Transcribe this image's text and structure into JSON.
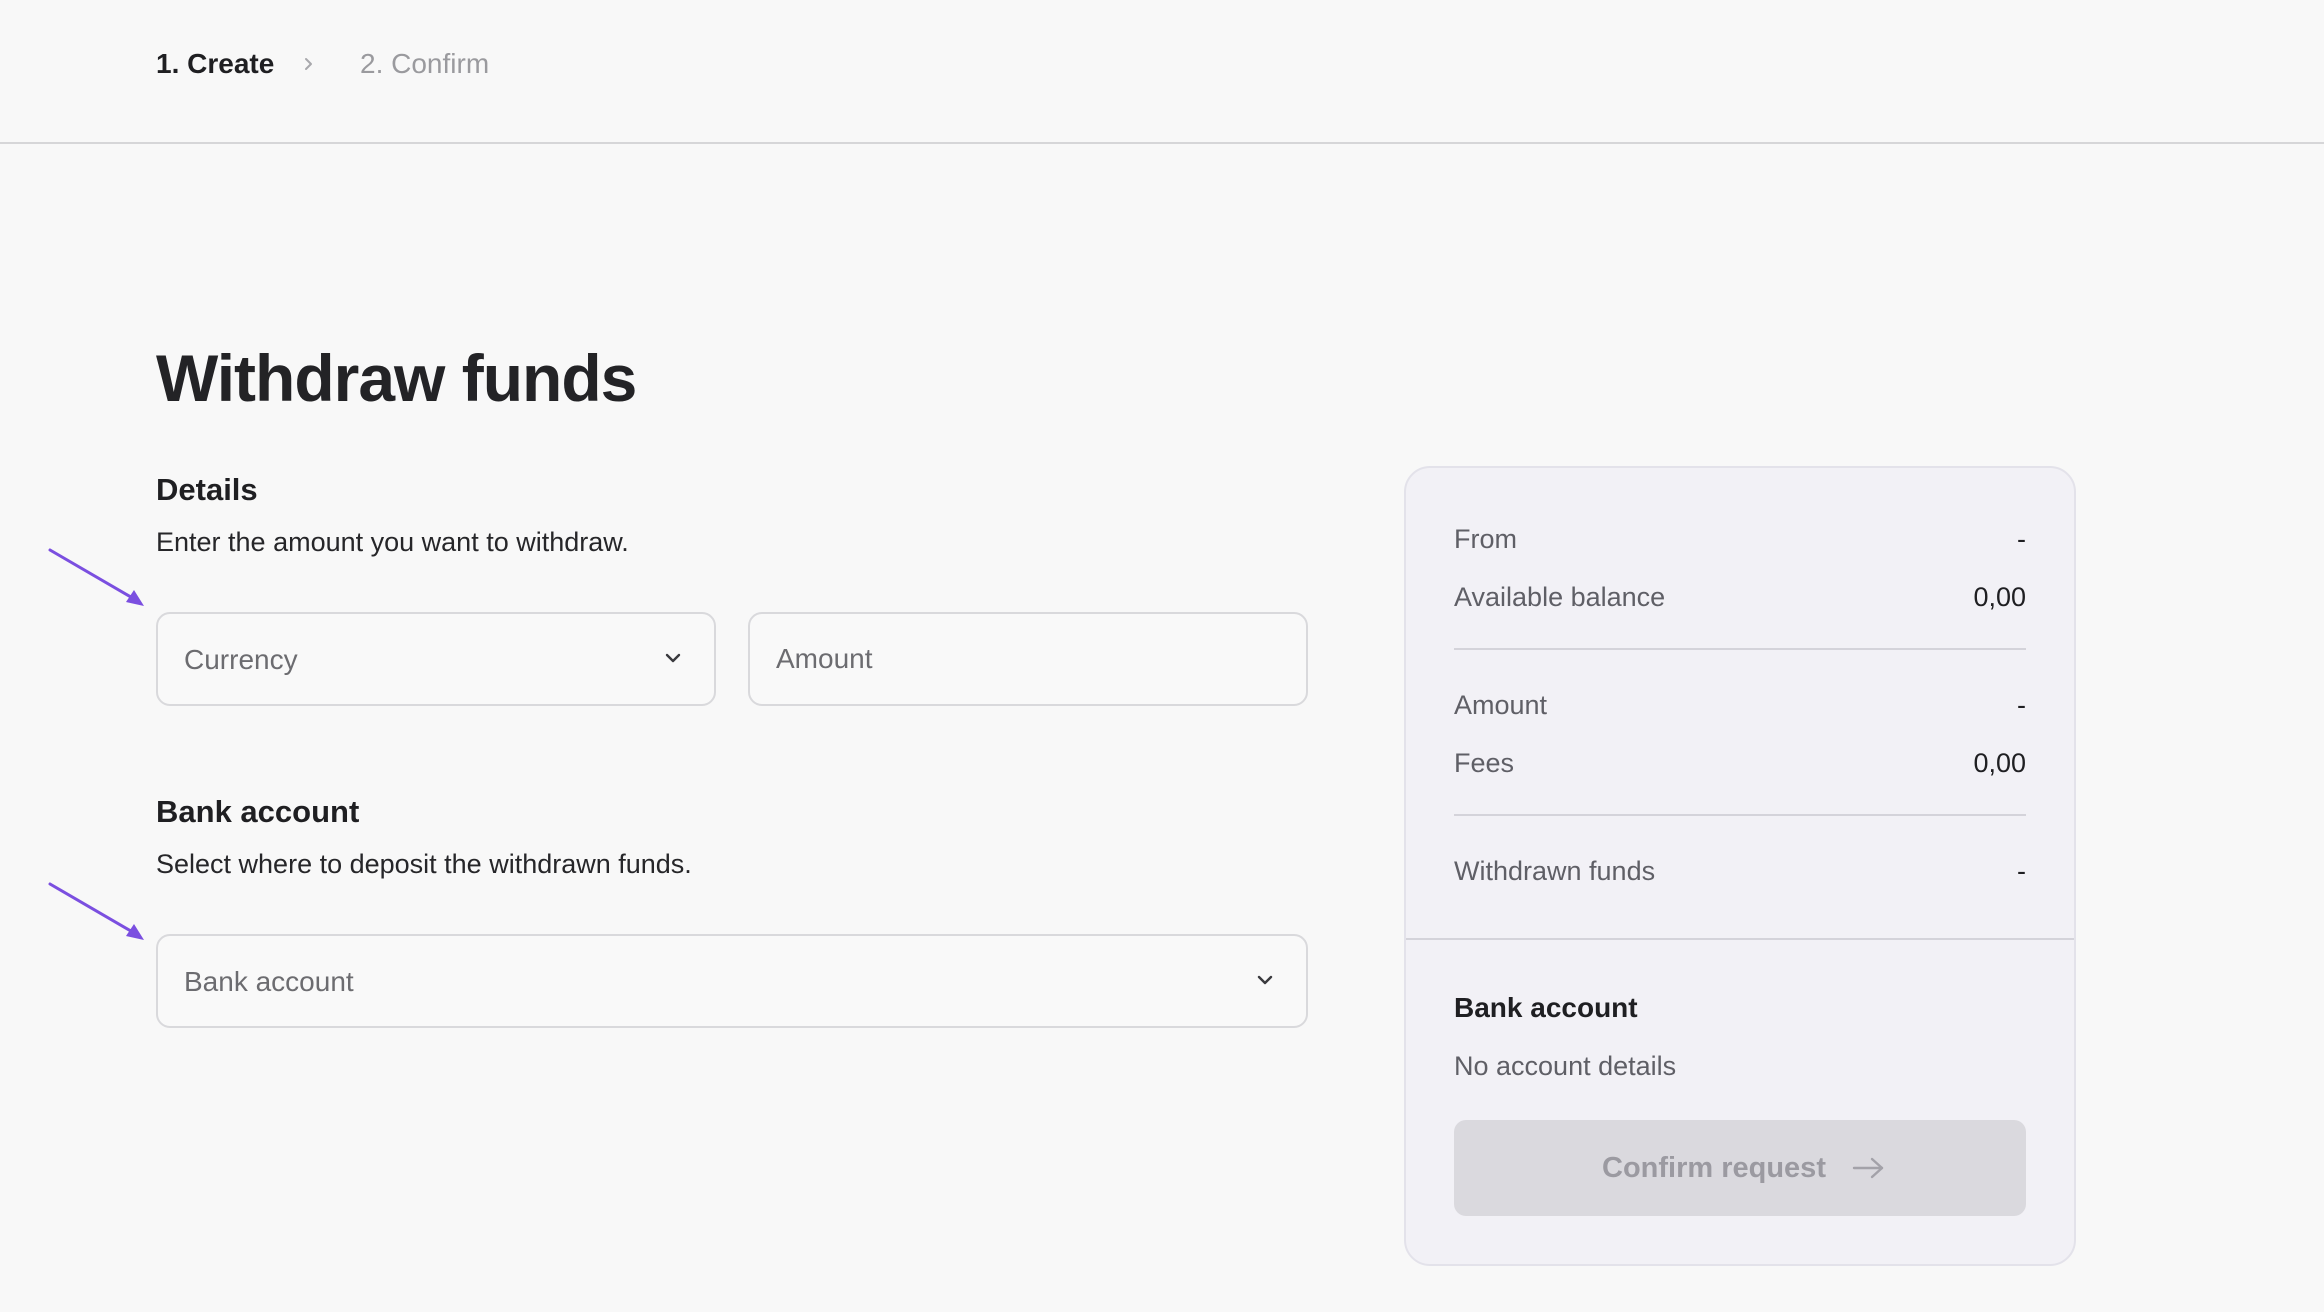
{
  "stepper": {
    "steps": [
      {
        "label": "1. Create",
        "active": true
      },
      {
        "label": "2. Confirm",
        "active": false
      }
    ],
    "separator_icon": "chevron-right-icon"
  },
  "page": {
    "title": "Withdraw funds"
  },
  "details": {
    "title": "Details",
    "description": "Enter the amount you want to withdraw.",
    "currency_select": {
      "placeholder": "Currency",
      "value": "",
      "icon": "chevron-down-icon"
    },
    "amount_input": {
      "placeholder": "Amount",
      "value": ""
    }
  },
  "bank": {
    "title": "Bank account",
    "description": "Select where to deposit the withdrawn funds.",
    "account_select": {
      "placeholder": "Bank account",
      "value": "",
      "icon": "chevron-down-icon"
    }
  },
  "summary": {
    "rows_group1": [
      {
        "label": "From",
        "value": "-"
      },
      {
        "label": "Available balance",
        "value": "0,00"
      }
    ],
    "rows_group2": [
      {
        "label": "Amount",
        "value": "-"
      },
      {
        "label": "Fees",
        "value": "0,00"
      }
    ],
    "rows_group3": [
      {
        "label": "Withdrawn funds",
        "value": "-"
      }
    ],
    "bank_title": "Bank account",
    "bank_details": "No account details",
    "confirm_button": {
      "label": "Confirm request",
      "disabled": true,
      "icon": "arrow-right-icon"
    }
  },
  "annotations": {
    "arrow_color": "#7b4fe0",
    "icon": "pointer-arrow-icon"
  },
  "colors": {
    "background": "#f8f8f8",
    "summary_background": "#f2f1f6",
    "disabled_button": "#dad9de",
    "annotation_arrow": "#7b4fe0"
  }
}
